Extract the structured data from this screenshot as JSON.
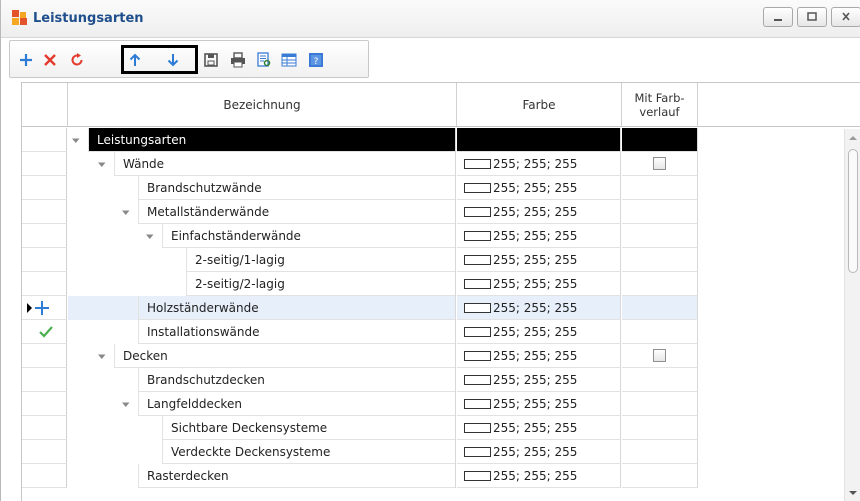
{
  "window": {
    "title": "Leistungsarten",
    "controls": [
      "minimize-icon",
      "maximize-icon",
      "close-icon"
    ]
  },
  "toolbar": {
    "buttons": [
      {
        "name": "add-button",
        "icon": "plus-icon",
        "color": "#2e7bd6"
      },
      {
        "name": "delete-button",
        "icon": "close-x-icon",
        "color": "#e23b2e"
      },
      {
        "name": "refresh-button",
        "icon": "refresh-icon",
        "color": "#e23b2e"
      },
      {
        "name": "move-up-button",
        "icon": "arrow-up-icon",
        "color": "#2e7bd6"
      },
      {
        "name": "move-down-button",
        "icon": "arrow-down-icon",
        "color": "#2e7bd6"
      },
      {
        "name": "save-button",
        "icon": "save-icon"
      },
      {
        "name": "print-button",
        "icon": "print-icon"
      },
      {
        "name": "preview-button",
        "icon": "preview-icon"
      },
      {
        "name": "columns-button",
        "icon": "columns-icon"
      },
      {
        "name": "help-button",
        "icon": "help-icon"
      }
    ]
  },
  "grid": {
    "columns": {
      "name": "Bezeichnung",
      "color": "Farbe",
      "gradient": "Mit Farb-\nverlauf"
    },
    "rows": [
      {
        "level": 0,
        "label": "Leistungsarten",
        "color": "",
        "expanded": true,
        "root": true,
        "checkbox": false
      },
      {
        "level": 1,
        "label": "Wände",
        "color": "255; 255; 255",
        "expanded": true,
        "checkbox": true
      },
      {
        "level": 2,
        "label": "Brandschutzwände",
        "color": "255; 255; 255",
        "checkbox": false
      },
      {
        "level": 2,
        "label": "Metallständerwände",
        "color": "255; 255; 255",
        "expanded": true,
        "checkbox": false
      },
      {
        "level": 3,
        "label": "Einfachständerwände",
        "color": "255; 255; 255",
        "expanded": true,
        "checkbox": false
      },
      {
        "level": 4,
        "label": "2-seitig/1-lagig",
        "color": "255; 255; 255",
        "checkbox": false
      },
      {
        "level": 4,
        "label": "2-seitig/2-lagig",
        "color": "255; 255; 255",
        "checkbox": false
      },
      {
        "level": 2,
        "label": "Holzständerwände",
        "color": "255; 255; 255",
        "checkbox": false,
        "selected": true,
        "indicator": "current-new"
      },
      {
        "level": 2,
        "label": "Installationswände",
        "color": "255; 255; 255",
        "checkbox": false,
        "indicator": "check"
      },
      {
        "level": 1,
        "label": "Decken",
        "color": "255; 255; 255",
        "expanded": true,
        "checkbox": true
      },
      {
        "level": 2,
        "label": "Brandschutzdecken",
        "color": "255; 255; 255",
        "checkbox": false
      },
      {
        "level": 2,
        "label": "Langfelddecken",
        "color": "255; 255; 255",
        "expanded": true,
        "checkbox": false
      },
      {
        "level": 3,
        "label": "Sichtbare Deckensysteme",
        "color": "255; 255; 255",
        "checkbox": false
      },
      {
        "level": 3,
        "label": "Verdeckte Deckensysteme",
        "color": "255; 255; 255",
        "checkbox": false
      },
      {
        "level": 2,
        "label": "Rasterdecken",
        "color": "255; 255; 255",
        "checkbox": false
      }
    ]
  },
  "colors": {
    "title": "#1f4e8c",
    "selection": "#e7effa",
    "accent_blue": "#2e7bd6",
    "accent_red": "#e23b2e",
    "check_green": "#4caf50"
  }
}
